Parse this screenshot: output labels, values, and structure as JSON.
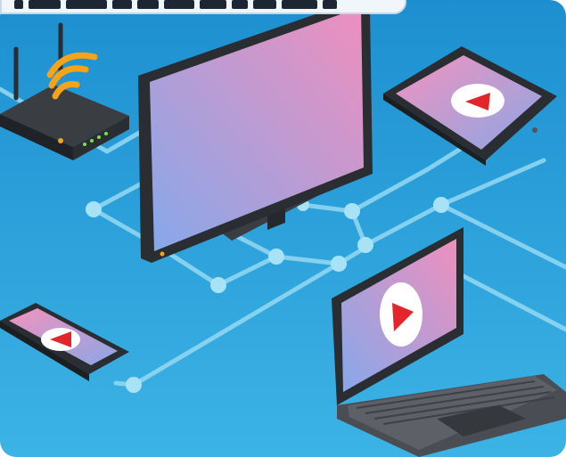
{
  "scene": {
    "subject": "connected-devices-network-illustration",
    "devices": [
      "wifi-router",
      "monitor",
      "tablet",
      "smartphone",
      "laptop"
    ],
    "colors": {
      "background_top": "#1d8fd0",
      "background_bottom": "#3fb2e4",
      "network_line": "#8fd6f2",
      "screen_pink": "#e98bbd",
      "screen_blue": "#8aa9e8",
      "device_dark": "#2f3338",
      "play_red": "#e3262b",
      "wifi_orange": "#f5a31a"
    }
  }
}
